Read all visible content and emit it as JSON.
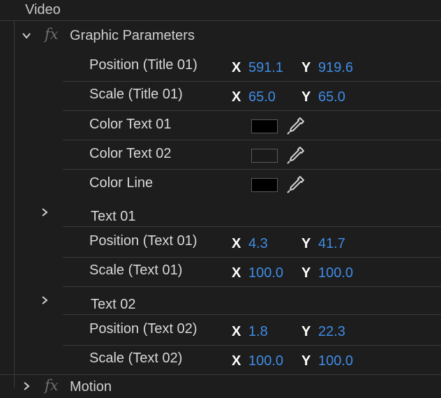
{
  "section": {
    "title": "Video"
  },
  "effect": {
    "fx_glyph": "fx",
    "name": "Graphic Parameters"
  },
  "rows": {
    "pos_title": {
      "label": "Position (Title 01)",
      "x_axis": "X",
      "x": "591.1",
      "y_axis": "Y",
      "y": "919.6"
    },
    "scale_title": {
      "label": "Scale (Title 01)",
      "x_axis": "X",
      "x": "65.0",
      "y_axis": "Y",
      "y": "65.0"
    },
    "color_text01": {
      "label": "Color Text 01",
      "swatch": "#000000"
    },
    "color_text02": {
      "label": "Color Text 02",
      "swatch": "#1a1a1a"
    },
    "color_line": {
      "label": "Color Line",
      "swatch": "#000000"
    },
    "group_text01": {
      "label": "Text 01"
    },
    "pos_text01": {
      "label": "Position (Text 01)",
      "x_axis": "X",
      "x": "4.3",
      "y_axis": "Y",
      "y": "41.7"
    },
    "scale_text01": {
      "label": "Scale (Text 01)",
      "x_axis": "X",
      "x": "100.0",
      "y_axis": "Y",
      "y": "100.0"
    },
    "group_text02": {
      "label": "Text 02"
    },
    "pos_text02": {
      "label": "Position (Text 02)",
      "x_axis": "X",
      "x": "1.8",
      "y_axis": "Y",
      "y": "22.3"
    },
    "scale_text02": {
      "label": "Scale (Text 02)",
      "x_axis": "X",
      "x": "100.0",
      "y_axis": "Y",
      "y": "100.0"
    }
  },
  "next_effect": {
    "fx_glyph": "fx",
    "name": "Motion"
  },
  "colors": {
    "value_blue": "#3f8ce6",
    "background": "#1d1d1d"
  },
  "icons": {
    "expand": "chevron-down-icon",
    "collapsed": "chevron-right-icon",
    "eyedropper": "eyedropper-icon"
  }
}
